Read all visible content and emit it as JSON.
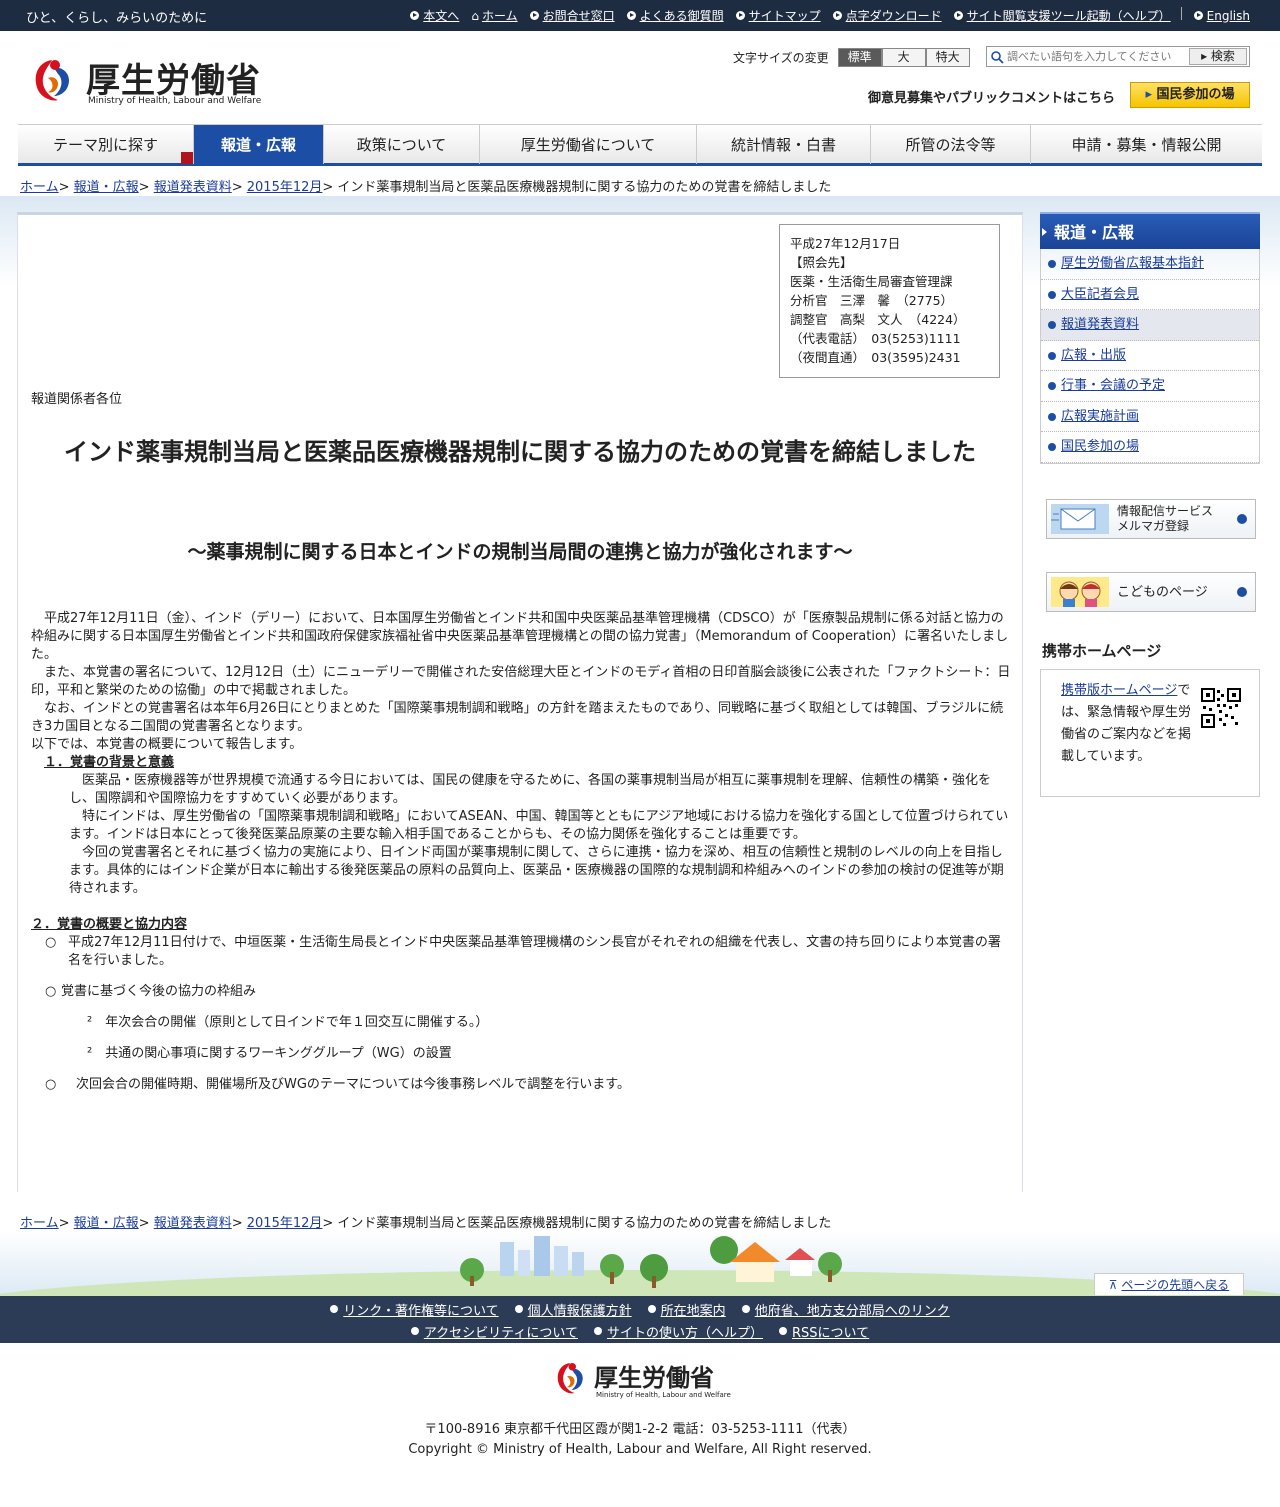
{
  "topbar": {
    "tagline": "ひと、くらし、みらいのために",
    "links": [
      "本文へ",
      "ホーム",
      "お問合せ窓口",
      "よくある御質問",
      "サイトマップ",
      "点字ダウンロード",
      "サイト閲覧支援ツール起動（ヘルプ）",
      "English"
    ]
  },
  "header": {
    "logo_name": "厚生労働省",
    "logo_sub": "Ministry of Health, Labour and Welfare",
    "fontsize_label": "文字サイズの変更",
    "fontsize_options": [
      "標準",
      "大",
      "特大"
    ],
    "search_placeholder": "調べたい語句を入力してください",
    "search_button": "検索",
    "public_comment": "御意見募集やパブリックコメントはこちら",
    "kokumin_button": "国民参加の場"
  },
  "nav": [
    "テーマ別に探す",
    "報道・広報",
    "政策について",
    "厚生労働省について",
    "統計情報・白書",
    "所管の法令等",
    "申請・募集・情報公開"
  ],
  "breadcrumb": {
    "links": [
      "ホーム",
      "報道・広報",
      "報道発表資料",
      "2015年12月"
    ],
    "current": "インド薬事規制当局と医薬品医療機器規制に関する協力のための覚書を締結しました"
  },
  "contact": {
    "lines": [
      "平成27年12月17日",
      "【照会先】",
      "医薬・生活衛生局審査管理課",
      "分析官　三澤　馨　（2775）",
      "調整官　高梨　文人　（4224）",
      "（代表電話）　03(5253)1111",
      "（夜間直通）　03(3595)2431"
    ]
  },
  "article": {
    "recipients": "報道関係者各位",
    "title": "インド薬事規制当局と医薬品医療機器規制に関する協力のための覚書を締結しました",
    "subtitle": "～薬事規制に関する日本とインドの規制当局間の連携と協力が強化されます～",
    "para1": "平成27年12月11日（金）、インド（デリー）において、日本国厚生労働省とインド共和国中央医薬品基準管理機構（CDSCO）が「医療製品規制に係る対話と協力の枠組みに関する日本国厚生労働省とインド共和国政府保健家族福祉省中央医薬品基準管理機構との間の協力覚書」（Memorandum of Cooperation）に署名いたしました。",
    "para2": "また、本覚書の署名について、12月12日（土）にニューデリーで開催された安倍総理大臣とインドのモディ首相の日印首脳会談後に公表された「ファクトシート：日印，平和と繁栄のための協働」の中で掲載されました。",
    "para3": "なお、インドとの覚書署名は本年6月26日にとりまとめた「国際薬事規制調和戦略」の方針を踏まえたものであり、同戦略に基づく取組としては韓国、ブラジルに続き3カ国目となる二国間の覚書署名となります。",
    "para4": "以下では、本覚書の概要について報告します。",
    "sec1": "１．覚書の背景と意義",
    "sec1_p1": "医薬品・医療機器等が世界規模で流通する今日においては、国民の健康を守るために、各国の薬事規制当局が相互に薬事規制を理解、信頼性の構築・強化をし、国際調和や国際協力をすすめていく必要があります。",
    "sec1_p2": "特にインドは、厚生労働省の「国際薬事規制調和戦略」においてASEAN、中国、韓国等とともにアジア地域における協力を強化する国として位置づけられています。インドは日本にとって後発医薬品原薬の主要な輸入相手国であることからも、その協力関係を強化することは重要です。",
    "sec1_p3": "今回の覚書署名とそれに基づく協力の実施により、日インド両国が薬事規制に関して、さらに連携・協力を深め、相互の信頼性と規制のレベルの向上を目指します。具体的にはインド企業が日本に輸出する後発医薬品の原料の品質向上、医薬品・医療機器の国際的な規制調和枠組みへのインドの参加の検討の促進等が期待されます。",
    "sec2": "２．覚書の概要と協力内容",
    "bullet_mark": "○",
    "sec2_b1": "平成27年12月11日付けで、中垣医薬・生活衛生局長とインド中央医薬品基準管理機構のシン長官がそれぞれの組織を代表し、文書の持ち回りにより本覚書の署名を行いました。",
    "sec2_b2": "覚書に基づく今後の協力の枠組み",
    "sub_mark": "²",
    "sec2_sub1": "年次会合の開催（原則として日インドで年１回交互に開催する。）",
    "sec2_sub2": "共通の関心事項に関するワーキンググループ（WG）の設置",
    "sec2_b3": "次回会合の開催時期、開催場所及びWGのテーマについては今後事務レベルで調整を行います。"
  },
  "sidebar": {
    "heading": "報道・広報",
    "items": [
      "厚生労働省広報基本指針",
      "大臣記者会見",
      "報道発表資料",
      "広報・出版",
      "行事・会議の予定",
      "広報実施計画",
      "国民参加の場"
    ],
    "mail_banner_line1": "情報配信サービス",
    "mail_banner_line2": "メルマガ登録",
    "kids_banner": "こどものページ",
    "mobile_heading": "携帯ホームページ",
    "mobile_link": "携帯版ホームページ",
    "mobile_text": "では、緊急情報や厚生労働省のご案内などを掲載しています。"
  },
  "footer": {
    "totop": "ページの先頭へ戻る",
    "links_row1": [
      "リンク・著作権等について",
      "個人情報保護方針",
      "所在地案内",
      "他府省、地方支分部局へのリンク"
    ],
    "links_row2": [
      "アクセシビリティについて",
      "サイトの使い方（ヘルプ）",
      "RSSについて"
    ],
    "address": "〒100-8916 東京都千代田区霞が関1-2-2 電話：03-5253-1111（代表）",
    "copyright": "Copyright © Ministry of Health, Labour and Welfare, All Right reserved."
  }
}
